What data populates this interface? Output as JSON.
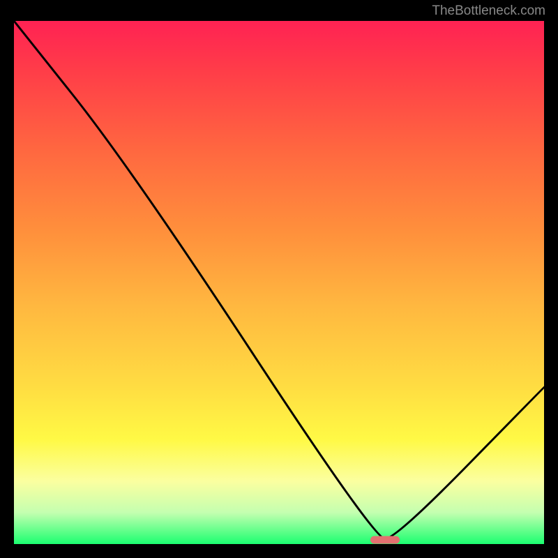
{
  "attribution": "TheBottleneck.com",
  "chart_data": {
    "type": "line",
    "title": "",
    "xlabel": "",
    "ylabel": "",
    "xlim": [
      0,
      100
    ],
    "ylim": [
      0,
      100
    ],
    "x": [
      0,
      22,
      68,
      72,
      100
    ],
    "values": [
      100,
      72,
      1,
      1,
      30
    ],
    "marker": {
      "x": 70,
      "y": 0.8
    },
    "background_gradient": {
      "stops": [
        {
          "pos": 0,
          "color": "#ff2253"
        },
        {
          "pos": 10,
          "color": "#ff3e48"
        },
        {
          "pos": 25,
          "color": "#ff6840"
        },
        {
          "pos": 40,
          "color": "#ff8f3c"
        },
        {
          "pos": 55,
          "color": "#ffb940"
        },
        {
          "pos": 70,
          "color": "#ffdd42"
        },
        {
          "pos": 80,
          "color": "#fff945"
        },
        {
          "pos": 88,
          "color": "#fbffa0"
        },
        {
          "pos": 94,
          "color": "#c4ffb0"
        },
        {
          "pos": 100,
          "color": "#1bff70"
        }
      ]
    }
  }
}
